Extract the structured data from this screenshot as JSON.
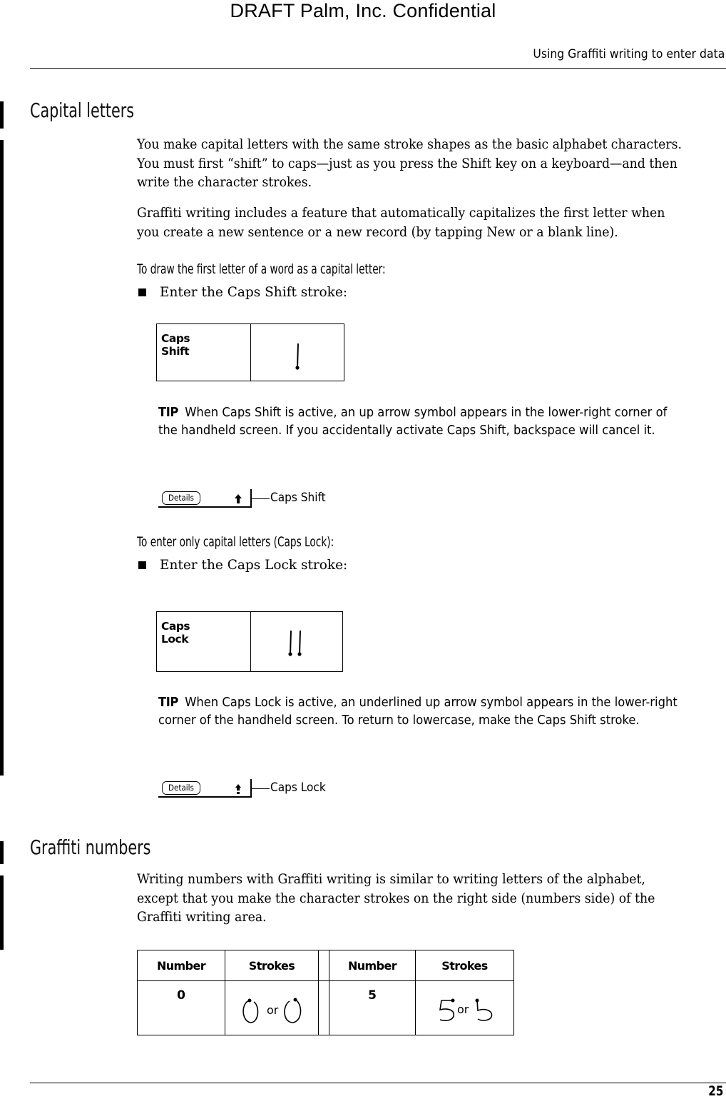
{
  "watermark": "DRAFT   Palm, Inc. Confidential",
  "running_head": "Using Graffiti writing to enter data",
  "sections": {
    "capital_letters": {
      "heading": "Capital letters",
      "paragraphs": [
        "You make capital letters with the same stroke shapes as the basic alphabet characters. You must first “shift” to caps—just as you press the Shift key on a keyboard—and then write the character strokes.",
        "Graffiti writing includes a feature that automatically capitalizes the first letter when you create a new sentence or a new record (by tapping New or a blank line)."
      ],
      "procedures": [
        {
          "title": "To draw the first letter of a word as a capital letter:",
          "step": "Enter the Caps Shift stroke:",
          "stroke_table": {
            "label_line1": "Caps",
            "label_line2": "Shift",
            "stroke_icon": "single-downstroke-icon"
          },
          "tip": {
            "label": "TIP",
            "text": "When Caps Shift is active, an up arrow symbol appears in the lower-right corner of the handheld screen. If you accidentally activate Caps Shift, backspace will cancel it."
          },
          "screen_snippet": {
            "button_label": "Details",
            "indicator_icon": "up-arrow-icon",
            "callout": "Caps Shift"
          }
        },
        {
          "title": "To enter only capital letters (Caps Lock):",
          "step": "Enter the Caps Lock stroke:",
          "stroke_table": {
            "label_line1": "Caps",
            "label_line2": "Lock",
            "stroke_icon": "double-downstroke-icon"
          },
          "tip": {
            "label": "TIP",
            "text": "When Caps Lock is active, an underlined up arrow symbol appears in the lower-right corner of the handheld screen. To return to lowercase, make the Caps Shift stroke."
          },
          "screen_snippet": {
            "button_label": "Details",
            "indicator_icon": "underlined-up-arrow-icon",
            "callout": "Caps Lock"
          }
        }
      ]
    },
    "graffiti_numbers": {
      "heading": "Graffiti numbers",
      "paragraph": "Writing numbers with Graffiti writing is similar to writing letters of the alphabet, except that you make the character strokes on the right side (numbers side) of the Graffiti writing area.",
      "table": {
        "headers": [
          "Number",
          "Strokes",
          "Number",
          "Strokes"
        ],
        "rows": [
          {
            "left_number": "0",
            "left_or": "or",
            "right_number": "5",
            "right_or": "or"
          }
        ]
      }
    }
  },
  "page_number": "25"
}
